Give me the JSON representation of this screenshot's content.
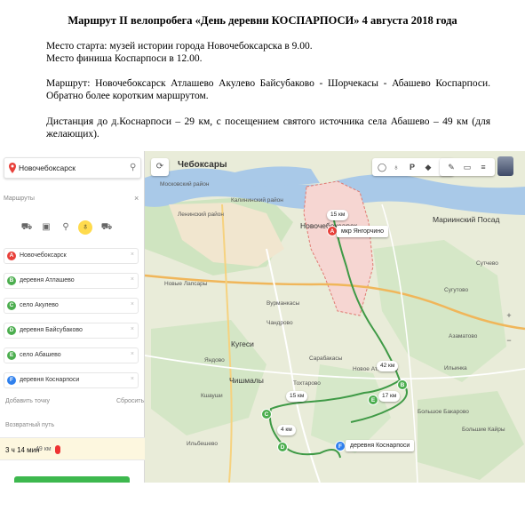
{
  "document": {
    "title": "Маршрут II велопробега «День деревни КОСПАРПОСИ» 4 августа 2018 года",
    "start_line": "Место старта: музей истории города Новочебоксарска в 9.00.",
    "finish_line": "Место финиша    Коспарпоси в 12.00.",
    "route_line": "Маршрут: Новочебоксарск    Атлашево    Акулево    Байсубаково - Шорчекасы - Абашево Коспарпоси. Обратно   более коротким маршрутом.",
    "distance_line": "Дистанция до д.Коснарпоси – 29 км, с посещением святого источника села Абашево – 49 км (для желающих)."
  },
  "map_app": {
    "search_value": "Новочебоксарск",
    "map_title": "Чебоксары",
    "routes_header": "Маршруты",
    "waypoints": [
      {
        "letter": "A",
        "label": "Новочебоксарск",
        "color": "#e8403a"
      },
      {
        "letter": "B",
        "label": "деревня Атлашево",
        "color": "#4cae4f"
      },
      {
        "letter": "C",
        "label": "село Акулево",
        "color": "#4cae4f"
      },
      {
        "letter": "D",
        "label": "деревня Байсубаково",
        "color": "#4cae4f"
      },
      {
        "letter": "E",
        "label": "село Абашево",
        "color": "#4cae4f"
      },
      {
        "letter": "F",
        "label": "деревня Коснарпоси",
        "color": "#2f80ed"
      }
    ],
    "add_point": "Добавить точку",
    "reset": "Сбросить",
    "back_route": "Возвратный путь",
    "result_time": "3 ч 14 мин",
    "result_dist": "49 км",
    "map_pills": {
      "start": "15 км",
      "start_place": "мкр Янгорчино",
      "mid": "42 км",
      "c": "15 км",
      "d": "4 км",
      "e": "17 км"
    },
    "finish_label": "деревня Коснарпоси",
    "place_labels": {
      "novoch": "Новочебоксарск",
      "mariinsky": "Мариинский Посад",
      "kugesi": "Кугеси",
      "chishmaly": "Чишмалы",
      "novoe_atlashevo": "Новое Атлашево",
      "lenin_district": "Ленинский район",
      "kalinin_district": "Калининский район",
      "moskovsky_district": "Московский район",
      "novye_lapsary": "Новые Лапсары",
      "chandrovo": "Чандрово",
      "yandovo": "Яндово",
      "kshaushi": "Кшауши",
      "tokhtarovo": "Тохтарово",
      "ilbeshevo": "Ильбешево",
      "chuvashsky": "Сарабакасы",
      "vurmankasy": "Вурманкасы",
      "atlashevo": "Атлашево",
      "akulevo": "Акулево",
      "bolshoe_bakarovo": "Большое Бакарово",
      "bolshie_kayry": "Большие Кайры",
      "kasanovo": "Азаматово",
      "ilyinka": "Ильинка",
      "sugutovo": "Сугутово",
      "sutchevo": "Сутчево"
    },
    "accent": "#ffdb4d",
    "route_color": "#3f9a46"
  }
}
